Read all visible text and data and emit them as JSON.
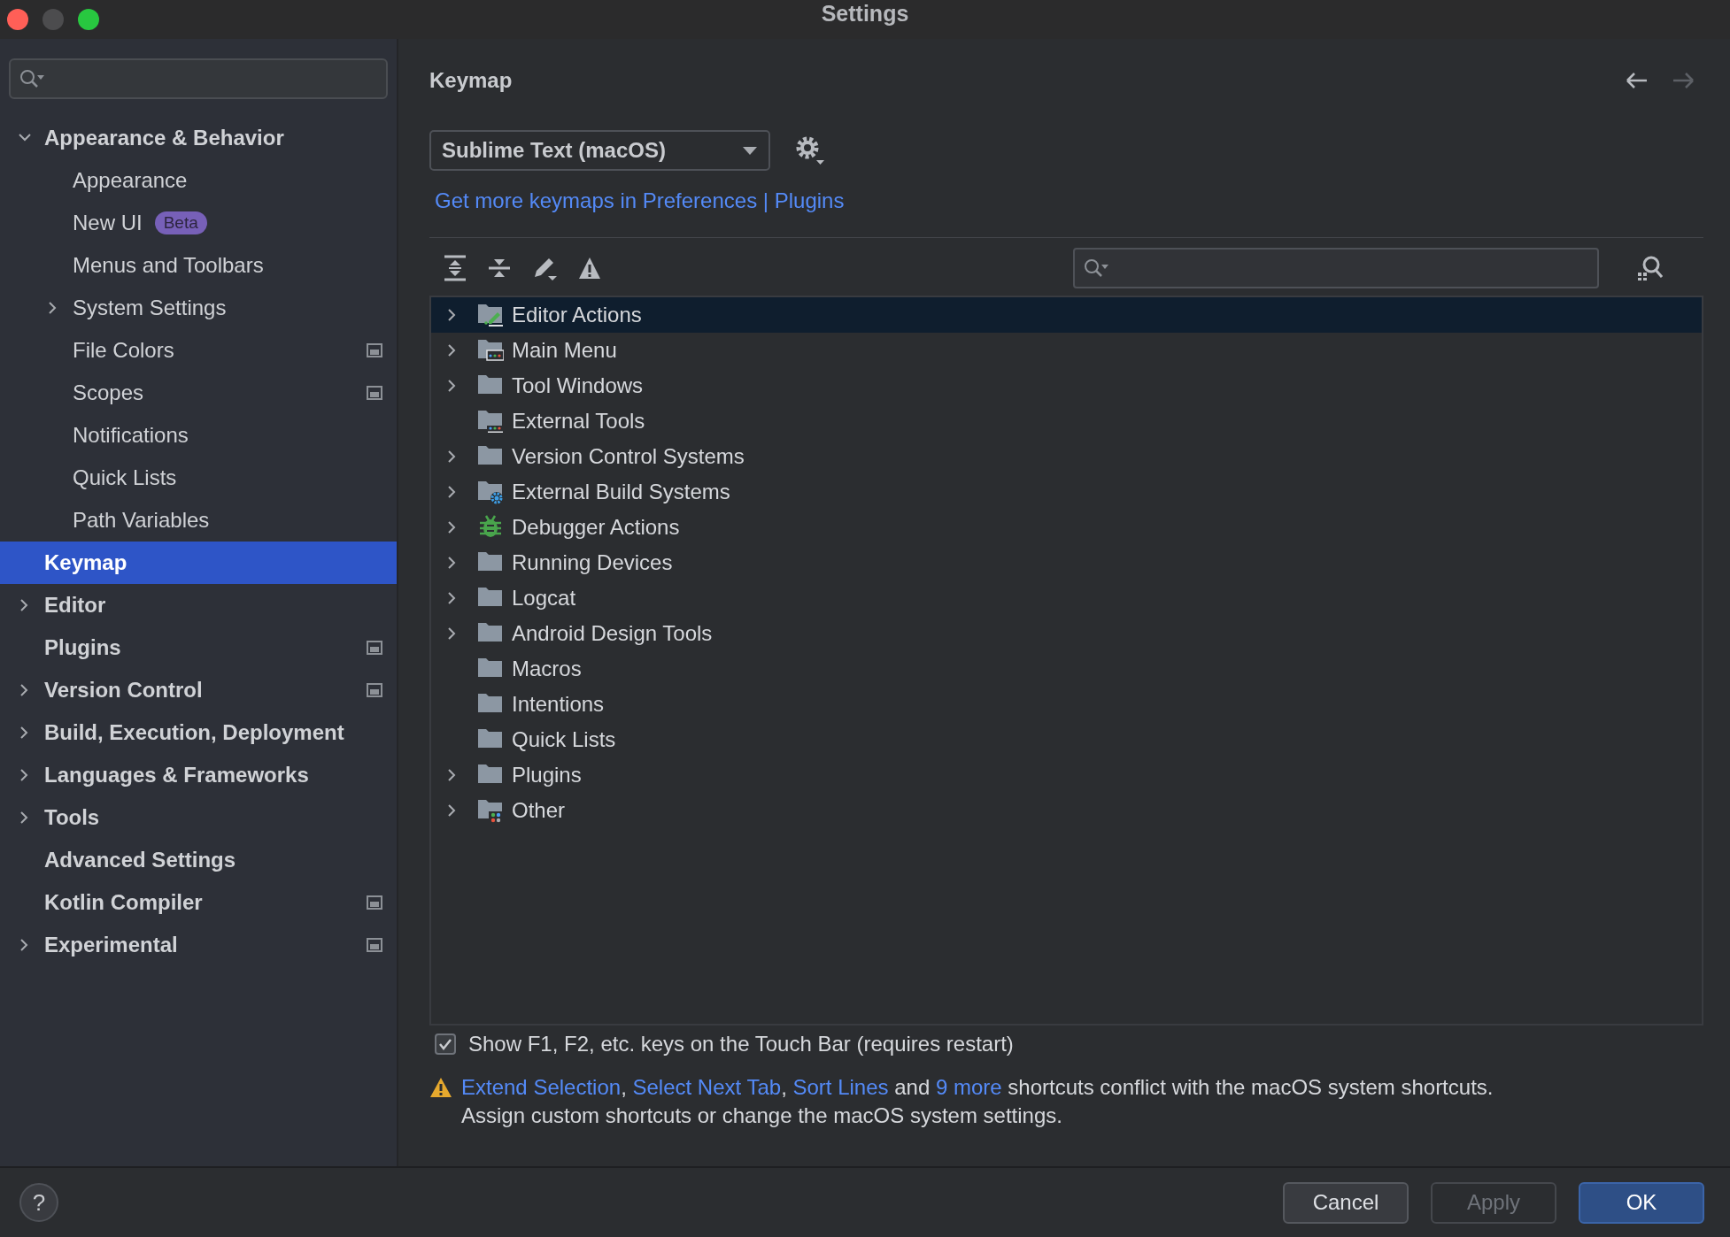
{
  "window": {
    "title": "Settings"
  },
  "sidebar": {
    "items": [
      {
        "label": "Appearance & Behavior",
        "selected": false,
        "expandable": true,
        "expanded": true,
        "project_scoped": false,
        "children": [
          {
            "label": "Appearance",
            "selected": false,
            "expandable": false,
            "project_scoped": false
          },
          {
            "label": "New UI",
            "badge": "Beta",
            "selected": false,
            "expandable": false,
            "project_scoped": false
          },
          {
            "label": "Menus and Toolbars",
            "selected": false,
            "expandable": false,
            "project_scoped": false
          },
          {
            "label": "System Settings",
            "selected": false,
            "expandable": true,
            "expanded": false,
            "project_scoped": false
          },
          {
            "label": "File Colors",
            "selected": false,
            "expandable": false,
            "project_scoped": true
          },
          {
            "label": "Scopes",
            "selected": false,
            "expandable": false,
            "project_scoped": true
          },
          {
            "label": "Notifications",
            "selected": false,
            "expandable": false,
            "project_scoped": false
          },
          {
            "label": "Quick Lists",
            "selected": false,
            "expandable": false,
            "project_scoped": false
          },
          {
            "label": "Path Variables",
            "selected": false,
            "expandable": false,
            "project_scoped": false
          }
        ]
      },
      {
        "label": "Keymap",
        "selected": true,
        "expandable": false,
        "project_scoped": false
      },
      {
        "label": "Editor",
        "selected": false,
        "expandable": true,
        "expanded": false,
        "project_scoped": false
      },
      {
        "label": "Plugins",
        "selected": false,
        "expandable": false,
        "project_scoped": true
      },
      {
        "label": "Version Control",
        "selected": false,
        "expandable": true,
        "expanded": false,
        "project_scoped": true
      },
      {
        "label": "Build, Execution, Deployment",
        "selected": false,
        "expandable": true,
        "expanded": false,
        "project_scoped": false
      },
      {
        "label": "Languages & Frameworks",
        "selected": false,
        "expandable": true,
        "expanded": false,
        "project_scoped": false
      },
      {
        "label": "Tools",
        "selected": false,
        "expandable": true,
        "expanded": false,
        "project_scoped": false
      },
      {
        "label": "Advanced Settings",
        "selected": false,
        "expandable": false,
        "project_scoped": false
      },
      {
        "label": "Kotlin Compiler",
        "selected": false,
        "expandable": false,
        "project_scoped": true
      },
      {
        "label": "Experimental",
        "selected": false,
        "expandable": true,
        "expanded": false,
        "project_scoped": true
      }
    ]
  },
  "keymap": {
    "title": "Keymap",
    "scheme": "Sublime Text (macOS)",
    "link": "Get more keymaps in Preferences | Plugins",
    "tree": [
      {
        "label": "Editor Actions",
        "kind": "editor",
        "expandable": true,
        "selected": true
      },
      {
        "label": "Main Menu",
        "kind": "menu",
        "expandable": true,
        "selected": false
      },
      {
        "label": "Tool Windows",
        "kind": "folder",
        "expandable": true,
        "selected": false
      },
      {
        "label": "External Tools",
        "kind": "tools",
        "expandable": false,
        "selected": false
      },
      {
        "label": "Version Control Systems",
        "kind": "folder",
        "expandable": true,
        "selected": false
      },
      {
        "label": "External Build Systems",
        "kind": "build",
        "expandable": true,
        "selected": false
      },
      {
        "label": "Debugger Actions",
        "kind": "debugger",
        "expandable": true,
        "selected": false
      },
      {
        "label": "Running Devices",
        "kind": "folder",
        "expandable": true,
        "selected": false
      },
      {
        "label": "Logcat",
        "kind": "folder",
        "expandable": true,
        "selected": false
      },
      {
        "label": "Android Design Tools",
        "kind": "folder",
        "expandable": true,
        "selected": false
      },
      {
        "label": "Macros",
        "kind": "folder",
        "expandable": false,
        "selected": false
      },
      {
        "label": "Intentions",
        "kind": "folder",
        "expandable": false,
        "selected": false
      },
      {
        "label": "Quick Lists",
        "kind": "folder",
        "expandable": false,
        "selected": false
      },
      {
        "label": "Plugins",
        "kind": "folder",
        "expandable": true,
        "selected": false
      },
      {
        "label": "Other",
        "kind": "other",
        "expandable": true,
        "selected": false
      }
    ]
  },
  "touch_bar": {
    "label": "Show F1, F2, etc. keys on the Touch Bar (requires restart)",
    "checked": true
  },
  "conflict": {
    "parts": [
      {
        "text": "Extend Selection",
        "link": true
      },
      {
        "text": ", ",
        "link": false
      },
      {
        "text": "Select Next Tab",
        "link": true
      },
      {
        "text": ", ",
        "link": false
      },
      {
        "text": "Sort Lines",
        "link": true
      },
      {
        "text": " and ",
        "link": false
      },
      {
        "text": "9 more",
        "link": true
      },
      {
        "text": " shortcuts conflict with the macOS system shortcuts.",
        "link": false
      }
    ],
    "note": "Assign custom shortcuts or change the macOS system settings."
  },
  "help": "?",
  "buttons": [
    {
      "label": "Cancel",
      "disabled": false,
      "default": false
    },
    {
      "label": "Apply",
      "disabled": true,
      "default": false
    },
    {
      "label": "OK",
      "disabled": false,
      "default": true
    }
  ]
}
